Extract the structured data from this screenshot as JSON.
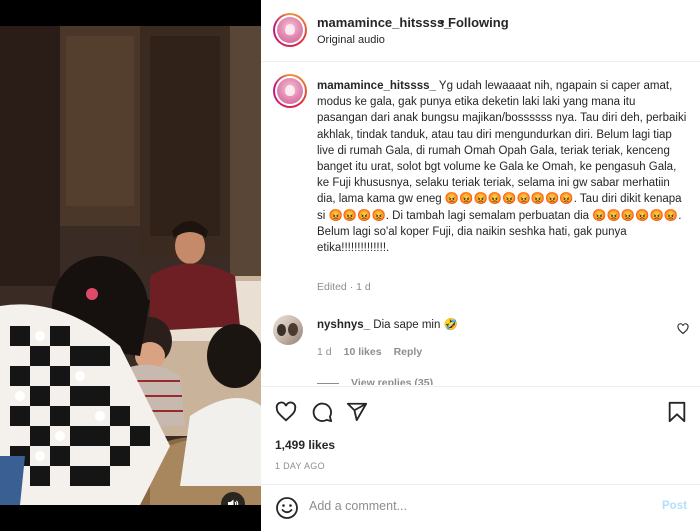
{
  "header": {
    "username": "mamamince_hitssss_",
    "separator": "•",
    "follow_state": "Following",
    "audio_label": "Original audio"
  },
  "caption": {
    "username": "mamamince_hitssss_",
    "line1": "Yg udah lewaaaat nih, ngapain si caper amat, modus ke gala, gak punya etika deketin laki laki yang mana itu pasangan dari anak bungsu majikan/bossssss nya. Tau diri deh, perbaiki akhlak, tindak tanduk, atau tau diri mengundurkan diri. Belum lagi tiap live di rumah Gala, di rumah Omah Opah Gala, teriak teriak, kenceng banget itu urat, solot bgt volume ke Gala ke Omah, ke pengasuh Gala, ke Fuji khususnya, selaku teriak teriak, selama ini gw sabar merhatiin dia, lama kama gw eneg",
    "emoji_run1": "😡😡😡😡😡😡😡😡😡",
    "line2": ". Tau diri dikit kenapa si",
    "emoji_run2": "😡😡😡😡",
    "line3": ". Di tambah lagi semalam perbuatan dia",
    "emoji_run3": "😡😡😡😡😡😡",
    "line4": ". Belum lagi so'al koper Fuji, dia naikin seshka hati, gak punya etika!!!!!!!!!!!!!!.",
    "meta": "Edited · 1 d"
  },
  "comment": {
    "username": "nyshnys_",
    "text": "Dia sape min",
    "emoji": "🤣",
    "time": "1 d",
    "likes": "10 likes",
    "reply": "Reply",
    "view_replies": "View replies (35)"
  },
  "actions": {
    "like_icon": "heart-icon",
    "comment_icon": "comment-icon",
    "share_icon": "share-icon",
    "save_icon": "bookmark-icon",
    "likes": "1,499 likes",
    "date": "1 DAY AGO"
  },
  "composer": {
    "placeholder": "Add a comment...",
    "post_label": "Post",
    "emoji_icon": "smiley-icon"
  },
  "media": {
    "volume_icon": "speaker-icon"
  },
  "colors": {
    "link_disabled": "#b2dffc",
    "muted": "#8e8e8e",
    "text": "#262626"
  }
}
